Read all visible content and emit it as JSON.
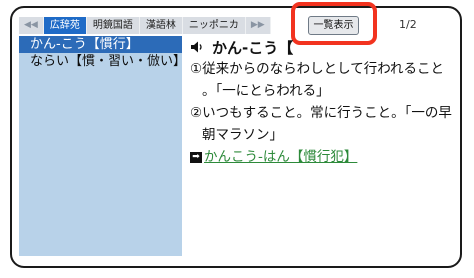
{
  "tabs": {
    "prev_arrow": "◀◀",
    "items": [
      "広辞苑",
      "明鏡国語",
      "漢語林",
      "ニッポニカ"
    ],
    "next_arrow": "▶▶"
  },
  "toolbar": {
    "list_view_label": "一覧表示",
    "page_indicator": "1/2"
  },
  "sidebar": {
    "items": [
      {
        "label": "かん‐こう【慣行】",
        "selected": true
      },
      {
        "label": "ならい【慣・習い・倣い】",
        "selected": false
      }
    ]
  },
  "entry": {
    "headword": "かん‐こう【",
    "definition1_line1": "①従来からのならわしとして行われること",
    "definition1_line2": "。「一にとらわれる」",
    "definition2_line1": "②いつもすること。常に行うこと。「一の早",
    "definition2_line2": "朝マラソン」",
    "cross_ref_arrow": "➡",
    "cross_ref_link": "かんこう‐はん【慣行犯】"
  },
  "colors": {
    "active_tab": "#1f6bc7",
    "sidebar_bg": "#b8d2e9",
    "sidebar_selected": "#2c6bb8",
    "highlight": "#f2331f",
    "link": "#2d8a3a"
  }
}
